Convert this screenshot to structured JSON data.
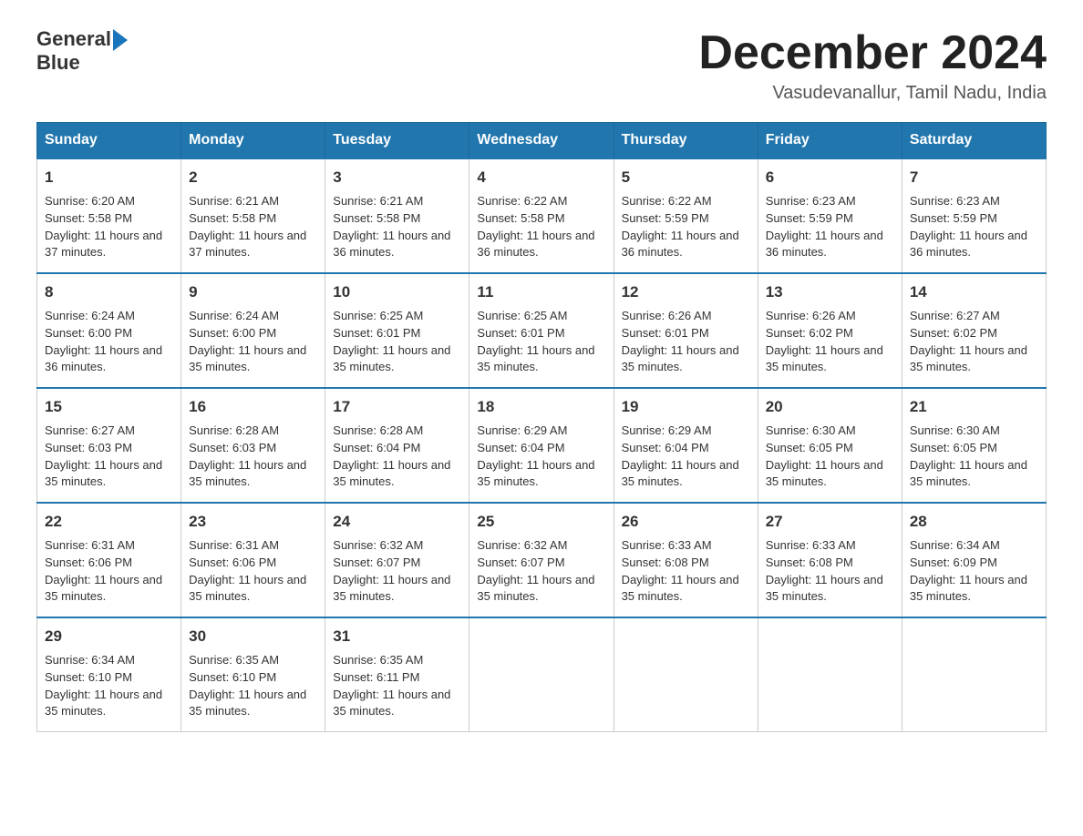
{
  "header": {
    "logo_general": "General",
    "logo_blue": "Blue",
    "month_title": "December 2024",
    "location": "Vasudevanallur, Tamil Nadu, India"
  },
  "days_of_week": [
    "Sunday",
    "Monday",
    "Tuesday",
    "Wednesday",
    "Thursday",
    "Friday",
    "Saturday"
  ],
  "weeks": [
    [
      {
        "day": "1",
        "sunrise": "6:20 AM",
        "sunset": "5:58 PM",
        "daylight": "11 hours and 37 minutes."
      },
      {
        "day": "2",
        "sunrise": "6:21 AM",
        "sunset": "5:58 PM",
        "daylight": "11 hours and 37 minutes."
      },
      {
        "day": "3",
        "sunrise": "6:21 AM",
        "sunset": "5:58 PM",
        "daylight": "11 hours and 36 minutes."
      },
      {
        "day": "4",
        "sunrise": "6:22 AM",
        "sunset": "5:58 PM",
        "daylight": "11 hours and 36 minutes."
      },
      {
        "day": "5",
        "sunrise": "6:22 AM",
        "sunset": "5:59 PM",
        "daylight": "11 hours and 36 minutes."
      },
      {
        "day": "6",
        "sunrise": "6:23 AM",
        "sunset": "5:59 PM",
        "daylight": "11 hours and 36 minutes."
      },
      {
        "day": "7",
        "sunrise": "6:23 AM",
        "sunset": "5:59 PM",
        "daylight": "11 hours and 36 minutes."
      }
    ],
    [
      {
        "day": "8",
        "sunrise": "6:24 AM",
        "sunset": "6:00 PM",
        "daylight": "11 hours and 36 minutes."
      },
      {
        "day": "9",
        "sunrise": "6:24 AM",
        "sunset": "6:00 PM",
        "daylight": "11 hours and 35 minutes."
      },
      {
        "day": "10",
        "sunrise": "6:25 AM",
        "sunset": "6:01 PM",
        "daylight": "11 hours and 35 minutes."
      },
      {
        "day": "11",
        "sunrise": "6:25 AM",
        "sunset": "6:01 PM",
        "daylight": "11 hours and 35 minutes."
      },
      {
        "day": "12",
        "sunrise": "6:26 AM",
        "sunset": "6:01 PM",
        "daylight": "11 hours and 35 minutes."
      },
      {
        "day": "13",
        "sunrise": "6:26 AM",
        "sunset": "6:02 PM",
        "daylight": "11 hours and 35 minutes."
      },
      {
        "day": "14",
        "sunrise": "6:27 AM",
        "sunset": "6:02 PM",
        "daylight": "11 hours and 35 minutes."
      }
    ],
    [
      {
        "day": "15",
        "sunrise": "6:27 AM",
        "sunset": "6:03 PM",
        "daylight": "11 hours and 35 minutes."
      },
      {
        "day": "16",
        "sunrise": "6:28 AM",
        "sunset": "6:03 PM",
        "daylight": "11 hours and 35 minutes."
      },
      {
        "day": "17",
        "sunrise": "6:28 AM",
        "sunset": "6:04 PM",
        "daylight": "11 hours and 35 minutes."
      },
      {
        "day": "18",
        "sunrise": "6:29 AM",
        "sunset": "6:04 PM",
        "daylight": "11 hours and 35 minutes."
      },
      {
        "day": "19",
        "sunrise": "6:29 AM",
        "sunset": "6:04 PM",
        "daylight": "11 hours and 35 minutes."
      },
      {
        "day": "20",
        "sunrise": "6:30 AM",
        "sunset": "6:05 PM",
        "daylight": "11 hours and 35 minutes."
      },
      {
        "day": "21",
        "sunrise": "6:30 AM",
        "sunset": "6:05 PM",
        "daylight": "11 hours and 35 minutes."
      }
    ],
    [
      {
        "day": "22",
        "sunrise": "6:31 AM",
        "sunset": "6:06 PM",
        "daylight": "11 hours and 35 minutes."
      },
      {
        "day": "23",
        "sunrise": "6:31 AM",
        "sunset": "6:06 PM",
        "daylight": "11 hours and 35 minutes."
      },
      {
        "day": "24",
        "sunrise": "6:32 AM",
        "sunset": "6:07 PM",
        "daylight": "11 hours and 35 minutes."
      },
      {
        "day": "25",
        "sunrise": "6:32 AM",
        "sunset": "6:07 PM",
        "daylight": "11 hours and 35 minutes."
      },
      {
        "day": "26",
        "sunrise": "6:33 AM",
        "sunset": "6:08 PM",
        "daylight": "11 hours and 35 minutes."
      },
      {
        "day": "27",
        "sunrise": "6:33 AM",
        "sunset": "6:08 PM",
        "daylight": "11 hours and 35 minutes."
      },
      {
        "day": "28",
        "sunrise": "6:34 AM",
        "sunset": "6:09 PM",
        "daylight": "11 hours and 35 minutes."
      }
    ],
    [
      {
        "day": "29",
        "sunrise": "6:34 AM",
        "sunset": "6:10 PM",
        "daylight": "11 hours and 35 minutes."
      },
      {
        "day": "30",
        "sunrise": "6:35 AM",
        "sunset": "6:10 PM",
        "daylight": "11 hours and 35 minutes."
      },
      {
        "day": "31",
        "sunrise": "6:35 AM",
        "sunset": "6:11 PM",
        "daylight": "11 hours and 35 minutes."
      },
      {
        "day": "",
        "sunrise": "",
        "sunset": "",
        "daylight": ""
      },
      {
        "day": "",
        "sunrise": "",
        "sunset": "",
        "daylight": ""
      },
      {
        "day": "",
        "sunrise": "",
        "sunset": "",
        "daylight": ""
      },
      {
        "day": "",
        "sunrise": "",
        "sunset": "",
        "daylight": ""
      }
    ]
  ]
}
